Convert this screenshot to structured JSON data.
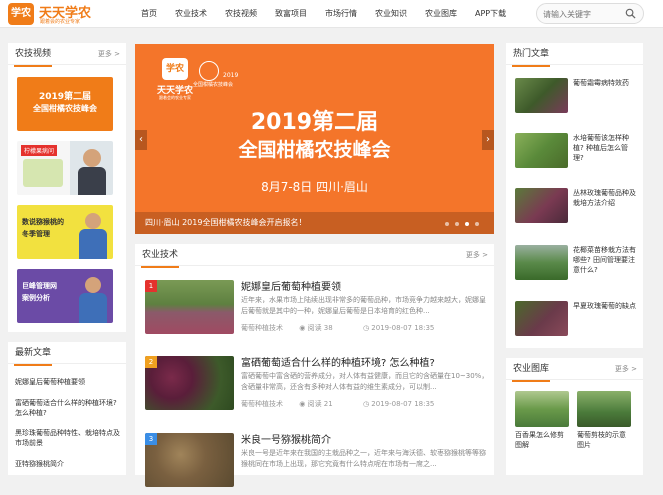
{
  "header": {
    "logo_mark": "学农",
    "logo_title": "天天学农",
    "logo_subtitle": "跟着会的农业专家",
    "nav": [
      "首页",
      "农业技术",
      "农技视频",
      "致富项目",
      "市场行情",
      "农业知识",
      "农业图库",
      "APP下载"
    ],
    "search_placeholder": "请输入关键字"
  },
  "video_section": {
    "title": "农技视频",
    "more": "更多 >",
    "items": [
      {
        "line1": "2019第二届",
        "line2": "全国柑橘农技峰会",
        "color": "#f07c18"
      },
      {
        "line1": "柠檬果病问",
        "line2": "",
        "color": "#e8e8e8"
      },
      {
        "line1": "数说猕猴桃的",
        "line2": "冬季管理",
        "color": "#e8d83a"
      },
      {
        "line1": "巨峰管理网",
        "line2": "案例分析",
        "color": "#6a4aa8"
      }
    ]
  },
  "banner": {
    "logo_mark": "学农",
    "logo_name": "天天学农",
    "logo_sub": "跟着会的农业专家",
    "seal_year": "2019",
    "seal_name": "全国柑橘农技峰会",
    "title_line1": "2019第二届",
    "title_line2": "全国柑橘农技峰会",
    "date_place": "8月7-8日 四川·眉山",
    "caption": "四川·眉山 2019全国柑橘农技峰会开启报名！",
    "prev": "‹",
    "next": "›",
    "active_dot": 2
  },
  "tech_section": {
    "title": "农业技术",
    "more": "更多 >",
    "articles": [
      {
        "rank": "1",
        "rank_color": "#e5322d",
        "title": "妮娜皇后葡萄种植要领",
        "desc": "近年来，水果市场上陆续出现非常多的葡萄品种，市场竞争力越来越大，妮娜皇后葡萄就是其中的一种，妮娜皇后葡萄是日本培育的红色种...",
        "category": "葡萄种植技术",
        "views": "阅读 38",
        "date": "2019-08-07 18:35"
      },
      {
        "rank": "2",
        "rank_color": "#f0a020",
        "title": "富硒葡萄适合什么样的种植环境? 怎么种植?",
        "desc": "富硒葡萄中富含硒的营养成分，对人体有益健康，而且它的含硒量在10~30%，含硒量非常高，还含有多种对人体有益的维生素成分，可以制...",
        "category": "葡萄种植技术",
        "views": "阅读 21",
        "date": "2019-08-07 18:35"
      },
      {
        "rank": "3",
        "rank_color": "#3a8ee6",
        "title": "米良一号猕猴桃简介",
        "desc": "米良一号是近年来在我国的主栽品种之一，近年来与海沃德、软枣猕猴桃等等猕猴桃同在市场上出现，那它究竟有什么特点呢在市场有一席之...",
        "category": "",
        "views": "",
        "date": ""
      }
    ]
  },
  "latest_section": {
    "title": "最新文章",
    "items": [
      "妮娜皇后葡萄种植要领",
      "富硒葡萄适合什么样的种植环境? 怎么种植?",
      "黑珍珠葡萄品种特性、栽培特点及市场前景",
      "亚特猕猴桃简介"
    ]
  },
  "hot_section": {
    "title": "热门文章",
    "items": [
      "葡萄霜霉病特效药",
      "水培葡萄该怎样种植? 种植后怎么管理?",
      "丛林玫瑰葡萄品种及栽培方法介绍",
      "花椰菜苗移栽方法有哪些? 田间管理要注意什么?",
      "早夏玫瑰葡萄的缺点"
    ]
  },
  "gallery_section": {
    "title": "农业图库",
    "more": "更多 >",
    "items": [
      "百香果怎么修剪图解",
      "葡萄剪枝的示意图片"
    ]
  }
}
